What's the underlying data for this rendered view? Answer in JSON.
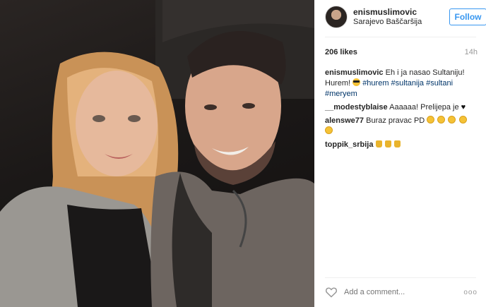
{
  "post": {
    "username": "enismuslimovic",
    "location": "Sarajevo Baščaršija",
    "follow_label": "Follow",
    "likes": "206 likes",
    "time": "14h"
  },
  "caption": {
    "author": "enismuslimovic",
    "text": "Eh i ja nasao Sultaniju! Hurem!",
    "tags": [
      "#hurem",
      "#sultanija",
      "#sultani",
      "#meryem"
    ]
  },
  "comments": [
    {
      "author": "__modestyblaise",
      "text": "Aaaaaa! Prelijepa je"
    },
    {
      "author": "alenswe77",
      "text": "Buraz pravac PD"
    },
    {
      "author": "toppik_srbija",
      "text": ""
    }
  ],
  "footer": {
    "add_comment_placeholder": "Add a comment...",
    "more_label": "ooo"
  },
  "colors": {
    "link_blue": "#3897f0",
    "hashtag": "#003569",
    "muted": "#999999"
  }
}
